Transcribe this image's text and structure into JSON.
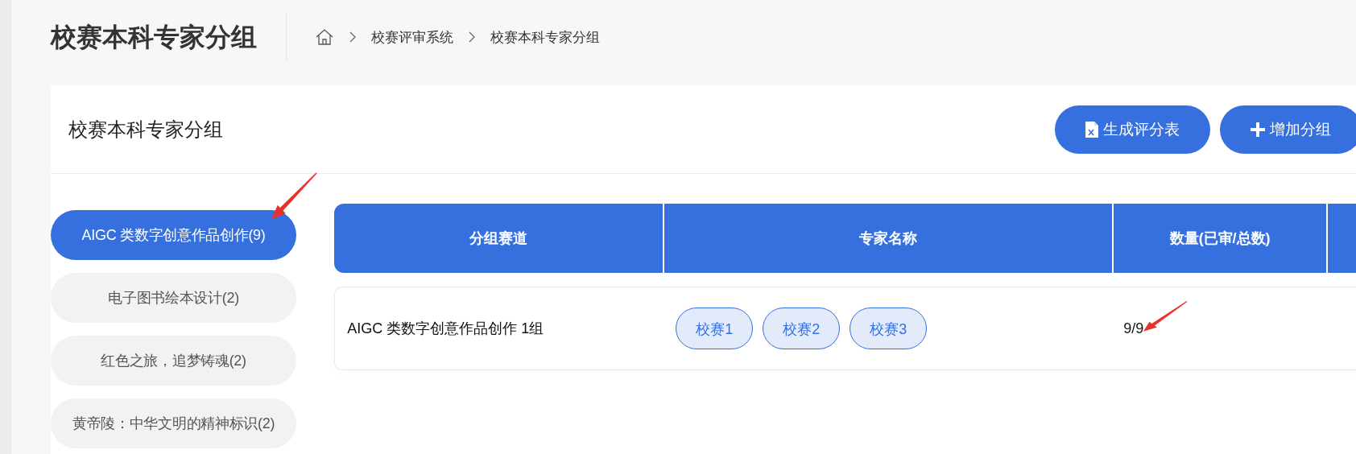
{
  "header": {
    "title": "校赛本科专家分组",
    "breadcrumb": [
      "校赛评审系统",
      "校赛本科专家分组"
    ]
  },
  "card": {
    "title": "校赛本科专家分组",
    "buttons": [
      {
        "kind": "excel",
        "label": "生成评分表"
      },
      {
        "kind": "add",
        "label": "增加分组"
      }
    ]
  },
  "groups": [
    {
      "label": "AIGC 类数字创意作品创作(9)",
      "selected": true,
      "marked": true
    },
    {
      "label": "电子图书绘本设计(2)",
      "selected": false,
      "marked": false
    },
    {
      "label": "红色之旅，追梦铸魂(2)",
      "selected": false,
      "marked": false
    },
    {
      "label": "黄帝陵：中华文明的精神标识(2)",
      "selected": false,
      "marked": false
    }
  ],
  "table": {
    "columns": [
      "分组赛道",
      "专家名称",
      "数量(已审/总数)"
    ],
    "rows": [
      {
        "track": "AIGC 类数字创意作品创作 1组",
        "experts": [
          "校赛1",
          "校赛2",
          "校赛3"
        ],
        "count": "9/9",
        "count_marked": true
      }
    ]
  }
}
